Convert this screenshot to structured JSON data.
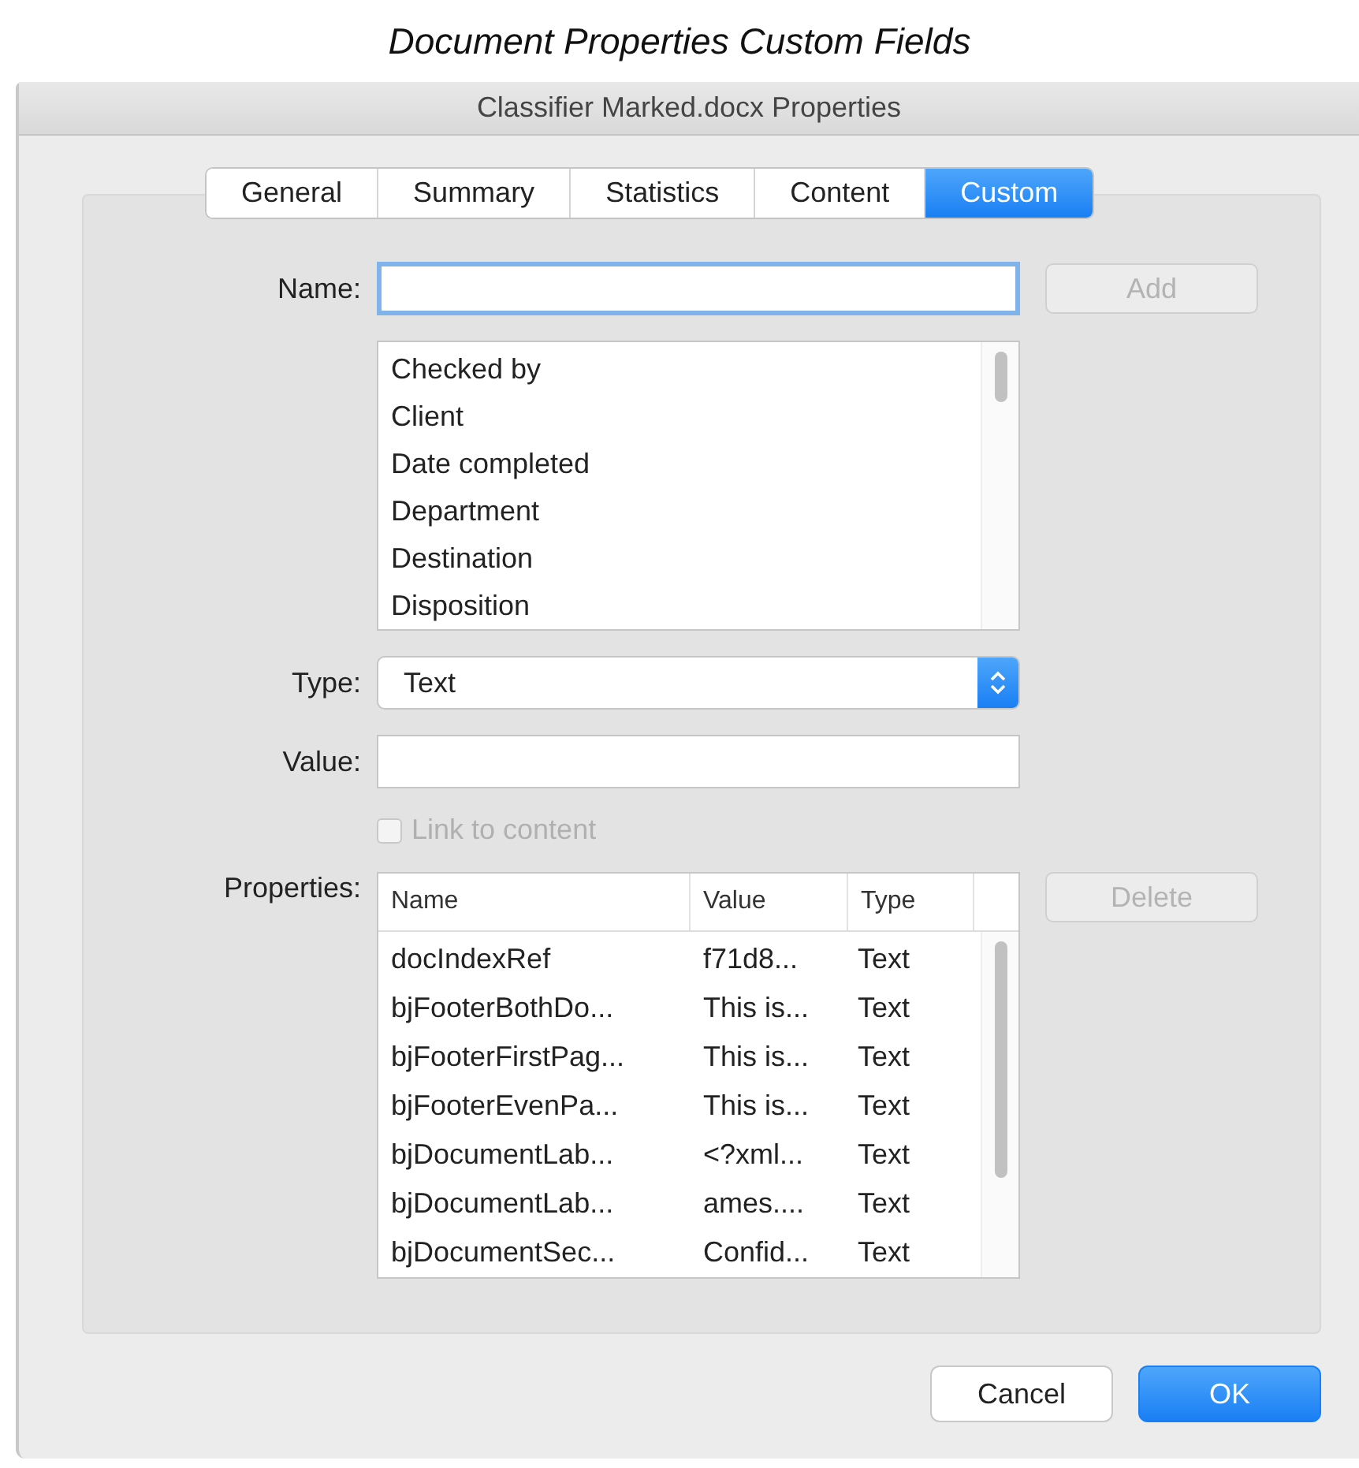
{
  "caption": "Document Properties Custom Fields",
  "window": {
    "title": "Classifier Marked.docx Properties"
  },
  "tabs": [
    {
      "label": "General",
      "selected": false
    },
    {
      "label": "Summary",
      "selected": false
    },
    {
      "label": "Statistics",
      "selected": false
    },
    {
      "label": "Content",
      "selected": false
    },
    {
      "label": "Custom",
      "selected": true
    }
  ],
  "name_field": {
    "label": "Name:",
    "focused": true
  },
  "add_button": {
    "label": "Add",
    "disabled": true
  },
  "field_names": [
    "Checked by",
    "Client",
    "Date completed",
    "Department",
    "Destination",
    "Disposition"
  ],
  "type_select": {
    "label": "Type:",
    "value": "Text"
  },
  "value_field": {
    "label": "Value:"
  },
  "link_to_content": {
    "label": "Link to content",
    "checked": false,
    "disabled": true
  },
  "properties": {
    "label": "Properties:",
    "columns": [
      "Name",
      "Value",
      "Type"
    ],
    "rows": [
      [
        "docIndexRef",
        "f71d8...",
        "Text"
      ],
      [
        "bjFooterBothDo...",
        "This is...",
        "Text"
      ],
      [
        "bjFooterFirstPag...",
        "This is...",
        "Text"
      ],
      [
        "bjFooterEvenPa...",
        "This is...",
        "Text"
      ],
      [
        "bjDocumentLab...",
        "<?xml...",
        "Text"
      ],
      [
        "bjDocumentLab...",
        "ames....",
        "Text"
      ],
      [
        "bjDocumentSec...",
        "Confid...",
        "Text"
      ]
    ]
  },
  "delete_button": {
    "label": "Delete",
    "disabled": true
  },
  "buttons": [
    {
      "label": "Cancel",
      "kind": "normal"
    },
    {
      "label": "OK",
      "kind": "primary"
    }
  ]
}
